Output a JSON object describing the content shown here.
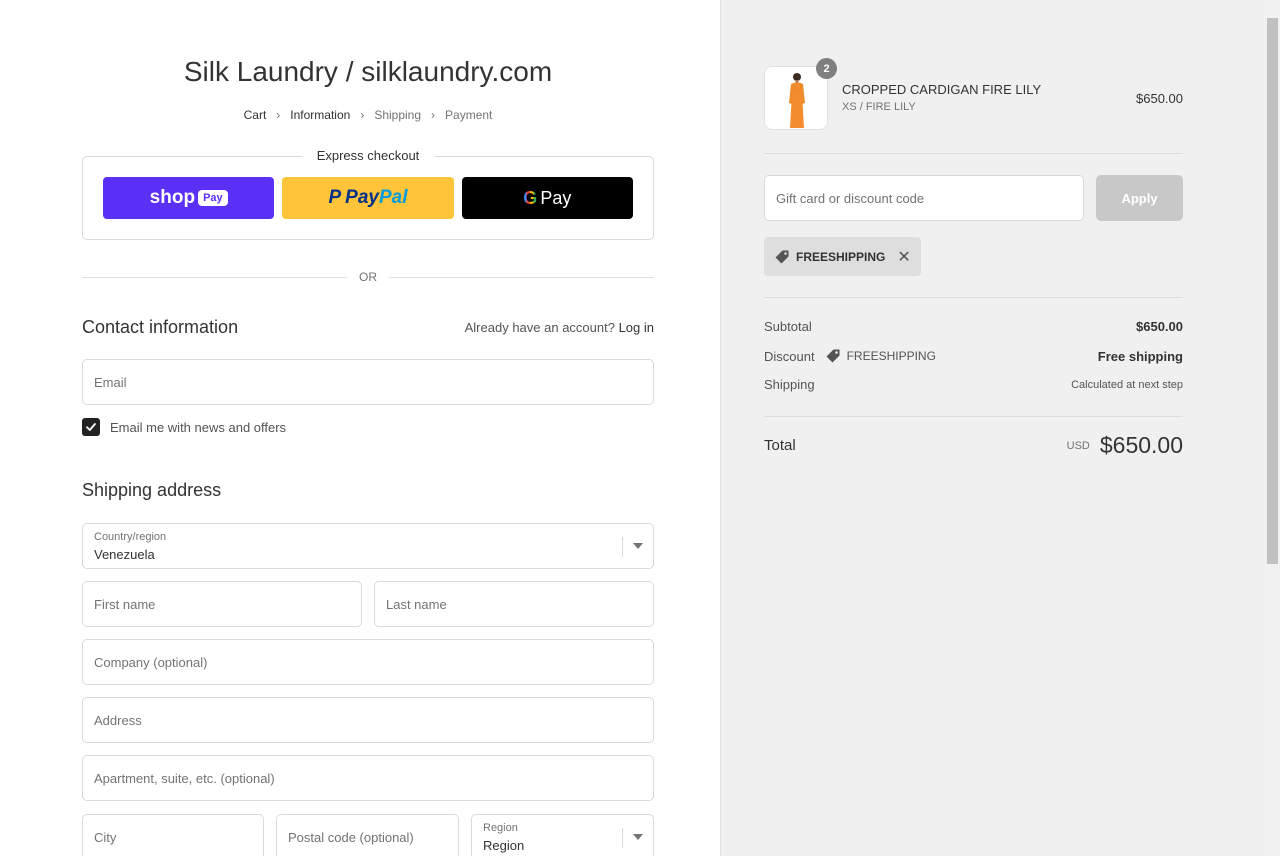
{
  "store": {
    "title": "Silk Laundry / silklaundry.com"
  },
  "breadcrumb": {
    "items": [
      "Cart",
      "Information",
      "Shipping",
      "Payment"
    ]
  },
  "express": {
    "title": "Express checkout",
    "shop_pay_text": "shop",
    "shop_pay_pill": "Pay",
    "paypal_p": "P",
    "paypal_pay": "Pay",
    "paypal_pal": "Pal",
    "gpay_g": "G",
    "gpay_pay": "Pay"
  },
  "or_text": "OR",
  "contact": {
    "title": "Contact information",
    "account_prompt": "Already have an account?",
    "login_label": "Log in",
    "email_placeholder": "Email",
    "newsletter_label": "Email me with news and offers",
    "newsletter_checked": true
  },
  "shipping": {
    "title": "Shipping address",
    "country_label": "Country/region",
    "country_value": "Venezuela",
    "first_name_placeholder": "First name",
    "last_name_placeholder": "Last name",
    "company_placeholder": "Company (optional)",
    "address_placeholder": "Address",
    "apartment_placeholder": "Apartment, suite, etc. (optional)",
    "city_placeholder": "City",
    "postal_placeholder": "Postal code (optional)",
    "region_label": "Region",
    "region_value": "Region"
  },
  "cart": {
    "product": {
      "name": "CROPPED CARDIGAN FIRE LILY",
      "variant": "XS / FIRE LILY",
      "price": "$650.00",
      "quantity": "2"
    },
    "discount_placeholder": "Gift card or discount code",
    "apply_label": "Apply",
    "applied_code": "FREESHIPPING",
    "subtotal_label": "Subtotal",
    "subtotal_value": "$650.00",
    "discount_label": "Discount",
    "discount_code": "FREESHIPPING",
    "discount_value": "Free shipping",
    "shipping_label": "Shipping",
    "shipping_value": "Calculated at next step",
    "total_label": "Total",
    "total_currency": "USD",
    "total_value": "$650.00"
  },
  "colors": {
    "shop_pay": "#5a31f4",
    "paypal": "#ffc439",
    "gpay": "#000000",
    "sidebar_bg": "#f0f0f0"
  }
}
